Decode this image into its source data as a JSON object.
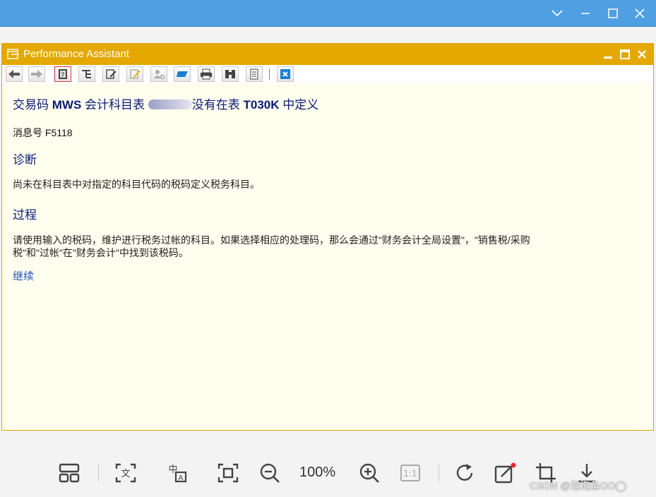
{
  "window": {
    "controls": [
      "chevron-down",
      "minimize",
      "maximize",
      "close"
    ]
  },
  "assistant": {
    "title": "Performance Assistant",
    "toolbar_icons": [
      "arrow-left-icon",
      "arrow-right-icon",
      "help-book-icon",
      "tech-info-icon",
      "edit-icon",
      "highlight-icon",
      "user-settings-icon",
      "flag-icon",
      "print-icon",
      "find-icon",
      "document-icon",
      "close-x-icon"
    ],
    "message": {
      "title_prefix": "交易码",
      "transaction_code": "MWS",
      "title_mid": "会计科目表",
      "title_suffix": "没有在表",
      "table_name": "T030K",
      "title_end": "中定义",
      "number_label": "消息号",
      "number": "F5118",
      "diagnosis_heading": "诊断",
      "diagnosis_text": "尚未在科目表中对指定的科目代码的税码定义税务科目。",
      "procedure_heading": "过程",
      "procedure_line1": "请使用输入的税码，维护进行税务过帐的科目。如果选择相应的处理码，那么会通过\"财务会计全局设置\"，\"销售税/采购",
      "procedure_line2": "税\"和\"过帐\"在\"财务会计\"中找到该税码。",
      "continue_link": "继续"
    }
  },
  "viewer_toolbar": {
    "zoom": "100%",
    "actual_size_label": "1:1",
    "watermark": "CSDN @泡泡鱼OO◯"
  },
  "colors": {
    "viewer_titlebar": "#4f9fe3",
    "assistant_titlebar": "#e4a800",
    "content_bg": "#ffffef",
    "heading_text": "#0a1a78",
    "link": "#1e56b8"
  }
}
